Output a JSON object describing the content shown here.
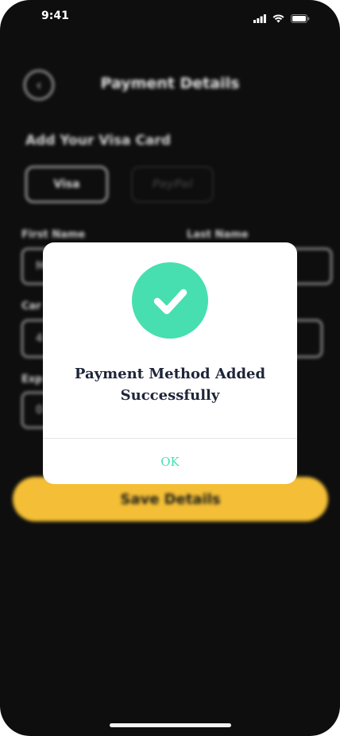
{
  "status_bar": {
    "time": "9:41"
  },
  "header": {
    "title": "Payment Details",
    "back_icon": "chevron-left-icon"
  },
  "section": {
    "title": "Add Your Visa Card"
  },
  "payment_methods": [
    "Visa",
    "PayPal"
  ],
  "form": {
    "first_name_label": "First Name",
    "last_name_label": "Last Name",
    "first_name_value": "M",
    "card_label": "Car",
    "card_value": "4",
    "expiry_label": "Exp",
    "expiry_value": "0"
  },
  "save_button": {
    "label": "Save Details",
    "color": "#f4bf36"
  },
  "modal": {
    "icon": "check-circle-icon",
    "message_line1": "Payment Method Added",
    "message_line2": "Successfully",
    "ok_label": "OK",
    "accent": "#47dfb0"
  }
}
